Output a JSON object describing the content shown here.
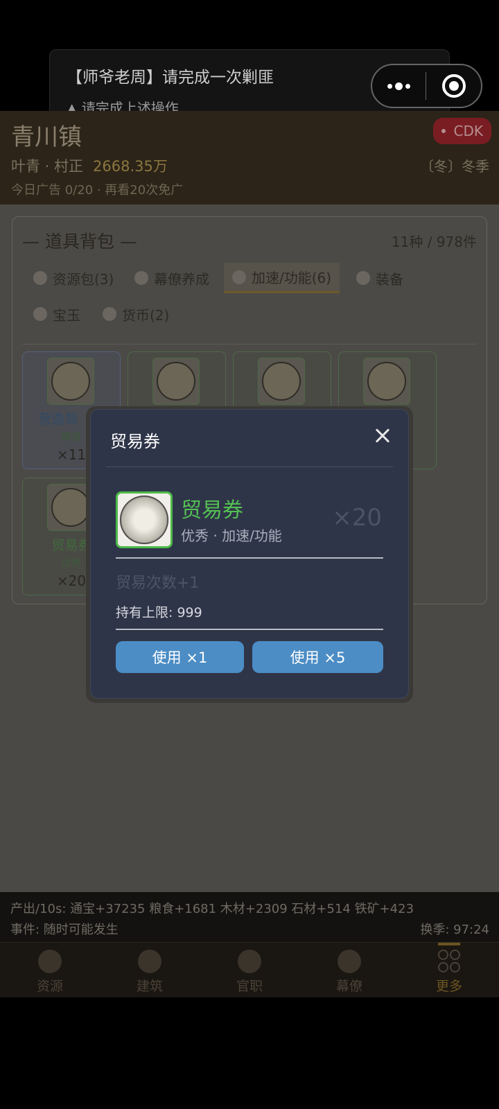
{
  "toast": {
    "title": "【师爷老周】请完成一次剿匪",
    "hint": "▲ 请完成上述操作"
  },
  "header": {
    "town": "青川镇",
    "cdk": "CDK",
    "player_name": "叶青 · 村正",
    "money": "2668.35万",
    "season": "〔冬〕冬季",
    "ads": "今日广告 0/20 · 再看20次免广"
  },
  "bag": {
    "title": "— 道具背包 —",
    "count": "11种 / 978件",
    "tabs": [
      {
        "label": "资源包(3)",
        "icon": "pouch-icon"
      },
      {
        "label": "幕僚养成",
        "icon": "scroll-icon"
      },
      {
        "label": "加速/功能(6)",
        "icon": "token-icon",
        "active": true
      },
      {
        "label": "装备",
        "icon": "armor-icon"
      },
      {
        "label": "宝玉",
        "icon": "jade-icon"
      },
      {
        "label": "货币(2)",
        "icon": "coin-icon"
      }
    ],
    "items": [
      {
        "name": "营造简（半",
        "grade": "精良",
        "qty": "×11"
      },
      {
        "name": "贸易券",
        "grade": "优秀",
        "qty": "×20"
      }
    ]
  },
  "modal": {
    "title": "贸易券",
    "item_name": "贸易券",
    "item_sub": "优秀 · 加速/功能",
    "item_qty": "×20",
    "effect": "贸易次数+1",
    "limit": "持有上限: 999",
    "btn_use1": "使用 ×1",
    "btn_use5": "使用 ×5",
    "colors": {
      "name": "#53c153",
      "button": "#4c8dc5",
      "panel": "#2f3548"
    }
  },
  "status": {
    "output": "产出/10s: 通宝+37235 粮食+1681 木材+2309 石材+514 铁矿+423",
    "event": "事件: 随时可能发生",
    "season_change": "换季: 97:24"
  },
  "nav": [
    {
      "label": "资源",
      "icon": "resource-icon"
    },
    {
      "label": "建筑",
      "icon": "building-icon"
    },
    {
      "label": "官职",
      "icon": "office-icon"
    },
    {
      "label": "幕僚",
      "icon": "advisor-icon"
    },
    {
      "label": "更多",
      "icon": "more-icon",
      "active": true
    }
  ]
}
